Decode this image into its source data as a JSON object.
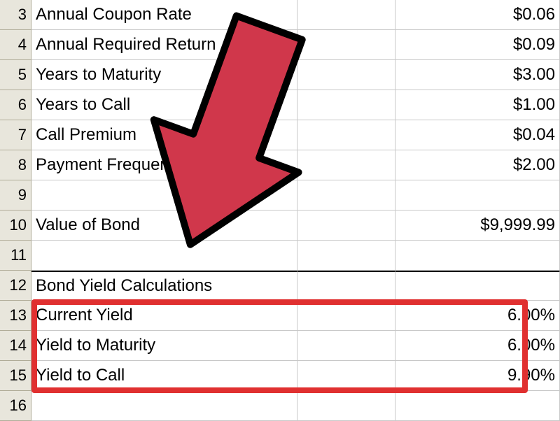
{
  "rows": [
    {
      "num": "3",
      "label": "Annual Coupon Rate",
      "value": "$0.06"
    },
    {
      "num": "4",
      "label": "Annual Required Return",
      "value": "$0.09"
    },
    {
      "num": "5",
      "label": "Years to Maturity",
      "value": "$3.00"
    },
    {
      "num": "6",
      "label": "Years to Call",
      "value": "$1.00"
    },
    {
      "num": "7",
      "label": "Call Premium",
      "value": "$0.04"
    },
    {
      "num": "8",
      "label": "Payment Frequency",
      "value": "$2.00"
    },
    {
      "num": "9",
      "label": "",
      "value": ""
    },
    {
      "num": "10",
      "label": "Value of Bond",
      "value": "$9,999.99"
    },
    {
      "num": "11",
      "label": "",
      "value": ""
    },
    {
      "num": "12",
      "label": "Bond Yield Calculations",
      "value": ""
    },
    {
      "num": "13",
      "label": "Current Yield",
      "value": "6.00%"
    },
    {
      "num": "14",
      "label": "Yield to Maturity",
      "value": "6.00%"
    },
    {
      "num": "15",
      "label": "Yield to Call",
      "value": "9.90%"
    },
    {
      "num": "16",
      "label": "",
      "value": ""
    }
  ],
  "annotation": {
    "arrow_color": "#d0374b",
    "box_color": "#e03030"
  }
}
